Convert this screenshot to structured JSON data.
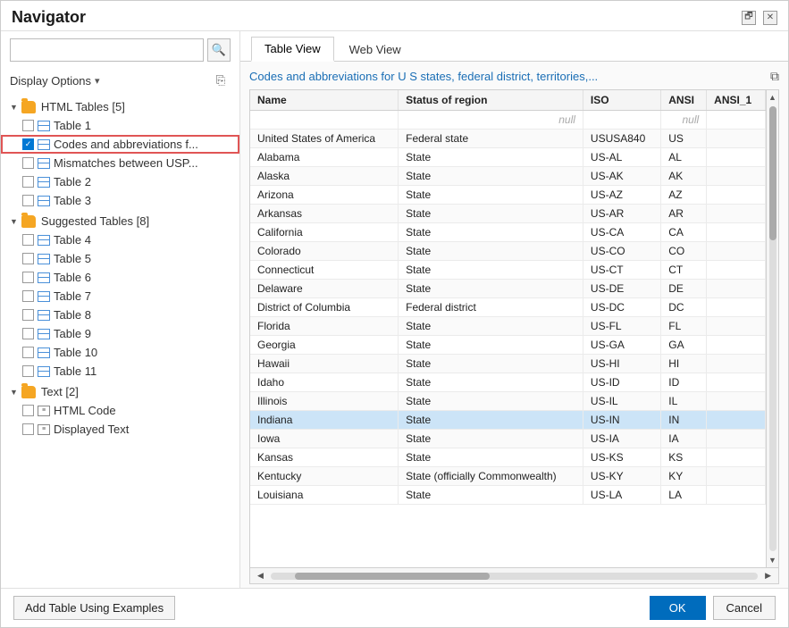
{
  "dialog": {
    "title": "Navigator"
  },
  "titlebar": {
    "restore_label": "🗗",
    "close_label": "✕"
  },
  "search": {
    "placeholder": "",
    "icon": "🔍"
  },
  "display_options": {
    "label": "Display Options",
    "arrow": "▾",
    "import_icon": "⎘"
  },
  "tree": {
    "groups": [
      {
        "id": "html-tables",
        "label": "HTML Tables [5]",
        "expanded": true,
        "items": [
          {
            "id": "table1",
            "label": "Table 1",
            "checked": false,
            "type": "table"
          },
          {
            "id": "codes",
            "label": "Codes and abbreviations f...",
            "checked": true,
            "type": "table",
            "selected": true
          },
          {
            "id": "mismatches",
            "label": "Mismatches between USP...",
            "checked": false,
            "type": "table"
          },
          {
            "id": "table2",
            "label": "Table 2",
            "checked": false,
            "type": "table"
          },
          {
            "id": "table3",
            "label": "Table 3",
            "checked": false,
            "type": "table"
          }
        ]
      },
      {
        "id": "suggested-tables",
        "label": "Suggested Tables [8]",
        "expanded": true,
        "items": [
          {
            "id": "table4",
            "label": "Table 4",
            "checked": false,
            "type": "table"
          },
          {
            "id": "table5",
            "label": "Table 5",
            "checked": false,
            "type": "table"
          },
          {
            "id": "table6",
            "label": "Table 6",
            "checked": false,
            "type": "table"
          },
          {
            "id": "table7",
            "label": "Table 7",
            "checked": false,
            "type": "table"
          },
          {
            "id": "table8",
            "label": "Table 8",
            "checked": false,
            "type": "table"
          },
          {
            "id": "table9",
            "label": "Table 9",
            "checked": false,
            "type": "table"
          },
          {
            "id": "table10",
            "label": "Table 10",
            "checked": false,
            "type": "table"
          },
          {
            "id": "table11",
            "label": "Table 11",
            "checked": false,
            "type": "table"
          }
        ]
      },
      {
        "id": "text",
        "label": "Text [2]",
        "expanded": true,
        "items": [
          {
            "id": "html-code",
            "label": "HTML Code",
            "checked": false,
            "type": "text"
          },
          {
            "id": "displayed-text",
            "label": "Displayed Text",
            "checked": false,
            "type": "text"
          }
        ]
      }
    ]
  },
  "tabs": [
    {
      "id": "table-view",
      "label": "Table View",
      "active": true
    },
    {
      "id": "web-view",
      "label": "Web View",
      "active": false
    }
  ],
  "preview": {
    "title": "Codes and abbreviations for U S states, federal district, territories,...",
    "export_icon": "⧉",
    "columns": [
      "Name",
      "Status of region",
      "ISO",
      "ANSI",
      "ANSI_1"
    ],
    "null_row": {
      "Name": "",
      "Status of region": "null",
      "ISO": "",
      "ANSI": "null",
      "ANSI_1": ""
    },
    "rows": [
      {
        "Name": "United States of America",
        "Status": "Federal state",
        "ISO": "USUSA840",
        "ANSI": "US",
        "ANSI_1": ""
      },
      {
        "Name": "Alabama",
        "Status": "State",
        "ISO": "US-AL",
        "ANSI": "AL",
        "ANSI_1": ""
      },
      {
        "Name": "Alaska",
        "Status": "State",
        "ISO": "US-AK",
        "ANSI": "AK",
        "ANSI_1": ""
      },
      {
        "Name": "Arizona",
        "Status": "State",
        "ISO": "US-AZ",
        "ANSI": "AZ",
        "ANSI_1": ""
      },
      {
        "Name": "Arkansas",
        "Status": "State",
        "ISO": "US-AR",
        "ANSI": "AR",
        "ANSI_1": ""
      },
      {
        "Name": "California",
        "Status": "State",
        "ISO": "US-CA",
        "ANSI": "CA",
        "ANSI_1": ""
      },
      {
        "Name": "Colorado",
        "Status": "State",
        "ISO": "US-CO",
        "ANSI": "CO",
        "ANSI_1": ""
      },
      {
        "Name": "Connecticut",
        "Status": "State",
        "ISO": "US-CT",
        "ANSI": "CT",
        "ANSI_1": ""
      },
      {
        "Name": "Delaware",
        "Status": "State",
        "ISO": "US-DE",
        "ANSI": "DE",
        "ANSI_1": ""
      },
      {
        "Name": "District of Columbia",
        "Status": "Federal district",
        "ISO": "US-DC",
        "ANSI": "DC",
        "ANSI_1": ""
      },
      {
        "Name": "Florida",
        "Status": "State",
        "ISO": "US-FL",
        "ANSI": "FL",
        "ANSI_1": ""
      },
      {
        "Name": "Georgia",
        "Status": "State",
        "ISO": "US-GA",
        "ANSI": "GA",
        "ANSI_1": ""
      },
      {
        "Name": "Hawaii",
        "Status": "State",
        "ISO": "US-HI",
        "ANSI": "HI",
        "ANSI_1": ""
      },
      {
        "Name": "Idaho",
        "Status": "State",
        "ISO": "US-ID",
        "ANSI": "ID",
        "ANSI_1": ""
      },
      {
        "Name": "Illinois",
        "Status": "State",
        "ISO": "US-IL",
        "ANSI": "IL",
        "ANSI_1": ""
      },
      {
        "Name": "Indiana",
        "Status": "State",
        "ISO": "US-IN",
        "ANSI": "IN",
        "ANSI_1": "",
        "highlight": true
      },
      {
        "Name": "Iowa",
        "Status": "State",
        "ISO": "US-IA",
        "ANSI": "IA",
        "ANSI_1": ""
      },
      {
        "Name": "Kansas",
        "Status": "State",
        "ISO": "US-KS",
        "ANSI": "KS",
        "ANSI_1": ""
      },
      {
        "Name": "Kentucky",
        "Status": "State (officially Commonwealth)",
        "ISO": "US-KY",
        "ANSI": "KY",
        "ANSI_1": ""
      },
      {
        "Name": "Louisiana",
        "Status": "State",
        "ISO": "US-LA",
        "ANSI": "LA",
        "ANSI_1": ""
      }
    ]
  },
  "footer": {
    "add_table_label": "Add Table Using Examples",
    "ok_label": "OK",
    "cancel_label": "Cancel"
  }
}
